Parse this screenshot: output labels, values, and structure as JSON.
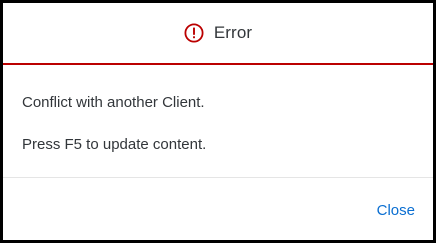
{
  "dialog": {
    "title": "Error",
    "icon": "error-icon",
    "accent_color": "#bb0000",
    "messages": [
      "Conflict with another Client.",
      "Press F5 to update content."
    ],
    "close_label": "Close",
    "link_color": "#0a6ed1"
  }
}
